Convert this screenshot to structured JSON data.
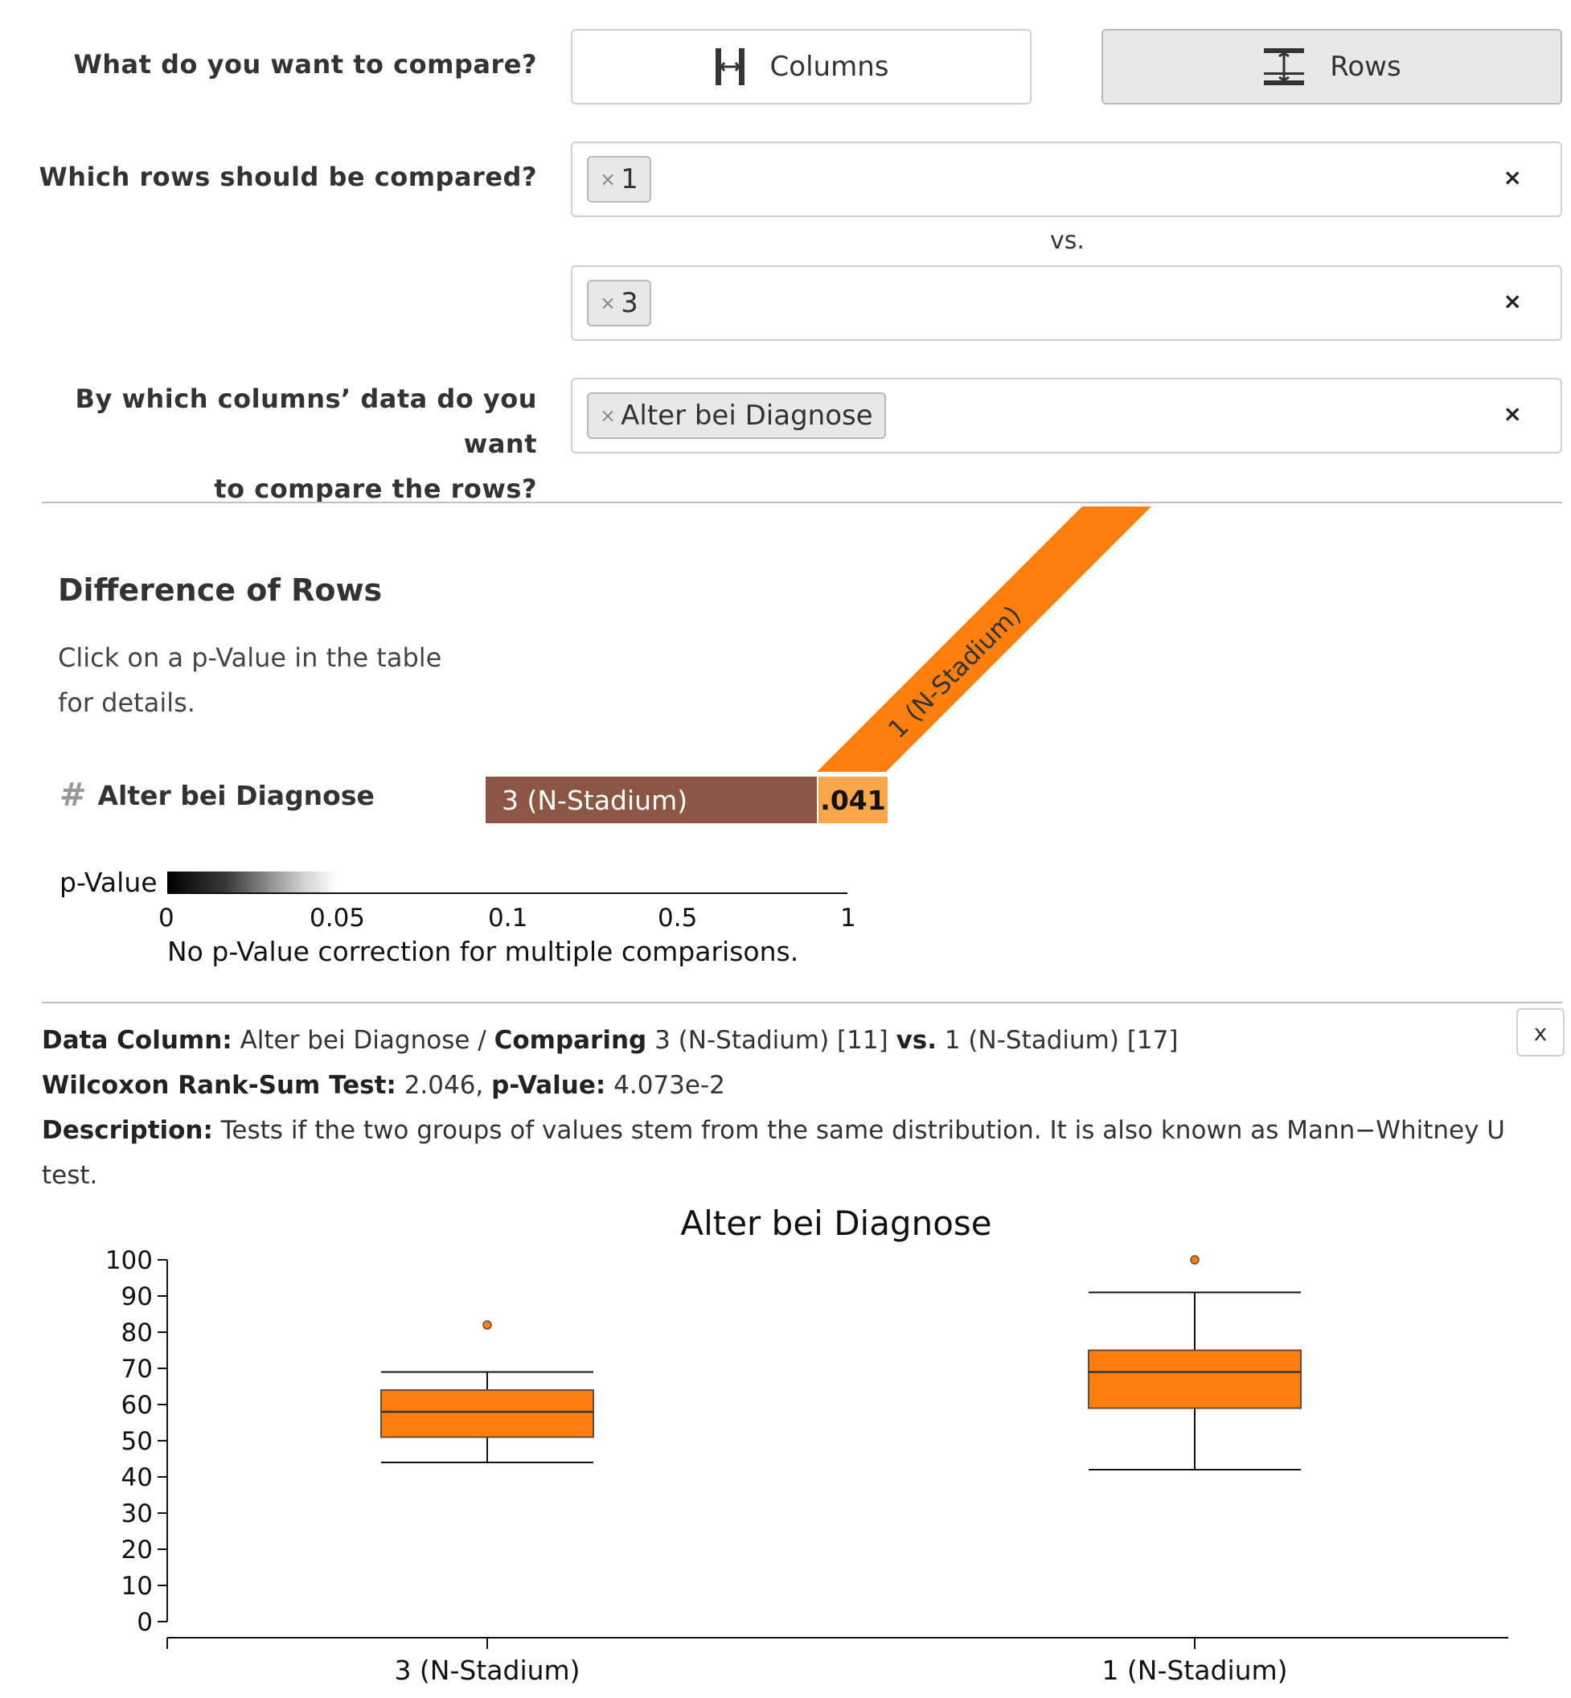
{
  "compare": {
    "question": "What do you want to compare?",
    "columns_label": "Columns",
    "rows_label": "Rows",
    "selected": "rows"
  },
  "rows_select": {
    "question": "Which rows should be compared?",
    "group_a": [
      "1"
    ],
    "vs_label": "vs.",
    "group_b": [
      "3"
    ]
  },
  "columns_select": {
    "question_line1": "By which columns’ data do you want",
    "question_line2": "to compare the rows?",
    "selected": [
      "Alter bei Diagnose"
    ]
  },
  "chip_remove_glyph": "×",
  "clear_glyph": "×",
  "difference": {
    "title": "Difference of Rows",
    "hint_line1": "Click on a p-Value in the table",
    "hint_line2": "for details.",
    "column_header": "1 (N-Stadium)",
    "row_label": "Alter bei Diagnose",
    "row_icon": "hash-icon",
    "row_group": "3 (N-Stadium)",
    "p_value_display": ".041",
    "header_color": "#ff7f0e",
    "row_color": "#8c5645",
    "cell_color": "#f7a64a"
  },
  "legend": {
    "title": "p-Value",
    "ticks": [
      "0",
      "0.05",
      "0.1",
      "0.5",
      "1"
    ],
    "note": "No p-Value correction for multiple comparisons."
  },
  "details": {
    "close_label": "x",
    "data_column_label": "Data Column:",
    "data_column_value": "Alter bei Diagnose",
    "separator": "/",
    "comparing_label": "Comparing",
    "group_a": "3 (N-Stadium) [11]",
    "vs_label": "vs.",
    "group_b": "1 (N-Stadium) [17]",
    "test_label": "Wilcoxon Rank-Sum Test:",
    "test_value": "2.046,",
    "pvalue_label": "p-Value:",
    "pvalue_value": "4.073e-2",
    "description_label": "Description:",
    "description_line1": "Tests if the two groups of values stem from the same distribution. It is also known as Mann−Whitney U",
    "description_line2": "test."
  },
  "chart_data": {
    "type": "boxplot",
    "title": "Alter bei Diagnose",
    "xlabel": "",
    "ylabel": "",
    "ylim": [
      0,
      100
    ],
    "yticks": [
      0,
      10,
      20,
      30,
      40,
      50,
      60,
      70,
      80,
      90,
      100
    ],
    "categories": [
      "3 (N-Stadium)",
      "1 (N-Stadium)"
    ],
    "boxes": [
      {
        "category": "3 (N-Stadium)",
        "whisker_low": 44,
        "q1": 51,
        "median": 58,
        "q3": 64,
        "whisker_high": 69,
        "outliers": [
          82
        ]
      },
      {
        "category": "1 (N-Stadium)",
        "whisker_low": 42,
        "q1": 59,
        "median": 69,
        "q3": 75,
        "whisker_high": 91,
        "outliers": [
          100
        ]
      }
    ],
    "color": "#ff7f0e"
  }
}
